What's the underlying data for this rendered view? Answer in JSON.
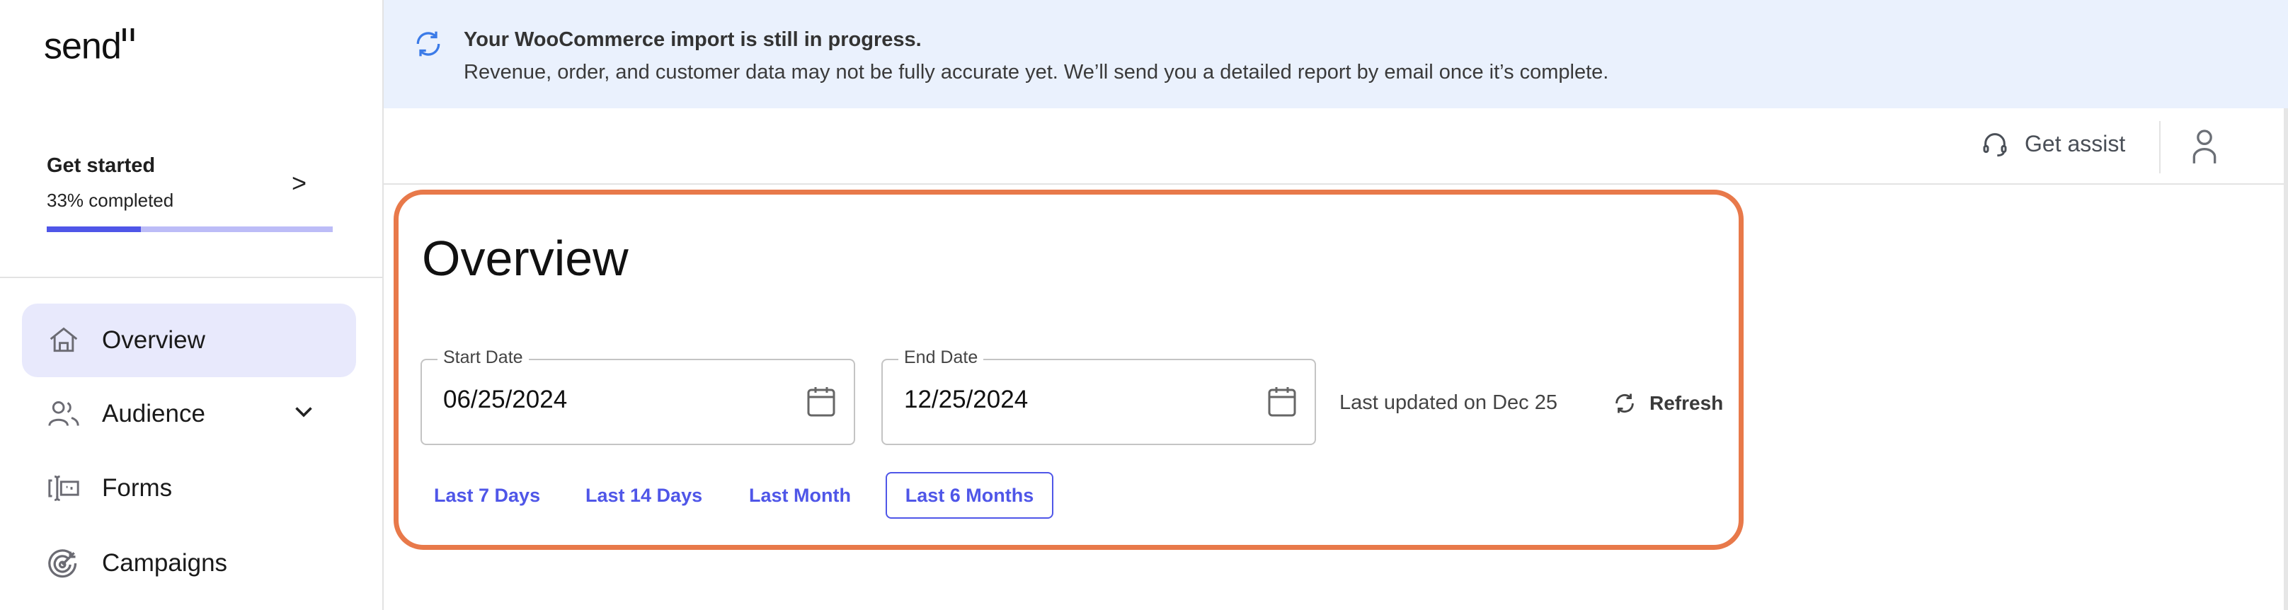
{
  "sidebar": {
    "logo": "send",
    "get_started": {
      "title": "Get started",
      "progress_text": "33% completed",
      "progress_percent": 33
    },
    "items": [
      {
        "label": "Overview",
        "icon": "home-icon",
        "active": true
      },
      {
        "label": "Audience",
        "icon": "users-icon",
        "has_submenu": true
      },
      {
        "label": "Forms",
        "icon": "form-icon"
      },
      {
        "label": "Campaigns",
        "icon": "target-icon"
      }
    ]
  },
  "banner": {
    "icon": "sync-icon",
    "title": "Your WooCommerce import is still in progress.",
    "message": "Revenue, order, and customer data may not be fully accurate yet. We’ll send you a detailed report by email once it’s complete."
  },
  "header": {
    "assist_label": "Get assist",
    "assist_icon": "headset-icon",
    "user_icon": "user-icon"
  },
  "main": {
    "title": "Overview",
    "start_date": {
      "label": "Start Date",
      "value": "06/25/2024"
    },
    "end_date": {
      "label": "End Date",
      "value": "12/25/2024"
    },
    "last_updated": "Last updated on Dec 25",
    "refresh_label": "Refresh",
    "quick_ranges": [
      {
        "label": "Last 7 Days",
        "selected": false
      },
      {
        "label": "Last 14 Days",
        "selected": false
      },
      {
        "label": "Last Month",
        "selected": false
      },
      {
        "label": "Last 6 Months",
        "selected": true
      }
    ]
  },
  "colors": {
    "accent": "#4f56e8",
    "highlight_border": "#e8794a",
    "banner_bg": "#eaf1fd",
    "active_nav_bg": "#e8e9fc"
  }
}
